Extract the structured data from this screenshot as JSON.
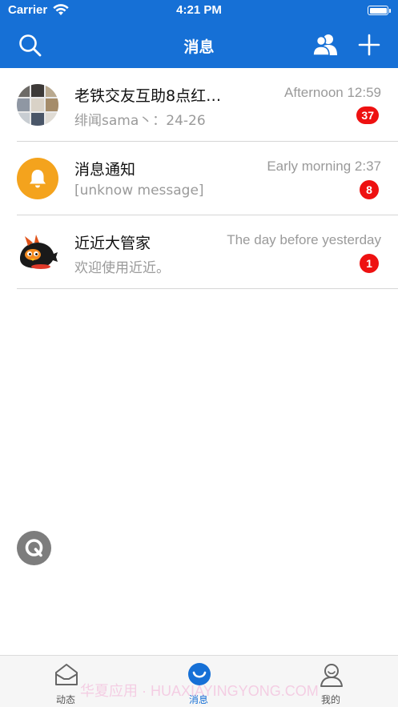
{
  "status_bar": {
    "carrier": "Carrier",
    "time": "4:21 PM",
    "icons": [
      "wifi-icon",
      "battery-icon"
    ]
  },
  "nav": {
    "title": "消息",
    "left_icon": "search-icon",
    "right_icons": [
      "contacts-icon",
      "plus-icon"
    ],
    "background_color": "#1670d6"
  },
  "conversations": [
    {
      "title": "老铁交友互助8点红…",
      "time": "Afternoon 12:59",
      "preview": "绯闻sama丶：24-26",
      "badge": "37",
      "avatar": "group-avatar-collage"
    },
    {
      "title": "消息通知",
      "time": "Early morning 2:37",
      "preview": "[unknow message]",
      "badge": "8",
      "avatar": "bell-icon",
      "avatar_color": "#f4a31d"
    },
    {
      "title": "近近大管家",
      "time": "The day before yesterday",
      "preview": "欢迎使用近近。",
      "badge": "1",
      "avatar": "bird-mascot-avatar"
    }
  ],
  "floating_button": {
    "icon": "q-logo-icon"
  },
  "tabs": [
    {
      "label": "动态",
      "icon": "inbox-icon",
      "active": false
    },
    {
      "label": "消息",
      "icon": "chat-bubble-icon",
      "active": true
    },
    {
      "label": "我的",
      "icon": "person-icon",
      "active": false
    }
  ],
  "watermark": "华夏应用 · HUAXIAYINGYONG.COM",
  "colors": {
    "accent": "#1670d6",
    "badge": "#ee1111",
    "muted_text": "#9a9a9a"
  }
}
